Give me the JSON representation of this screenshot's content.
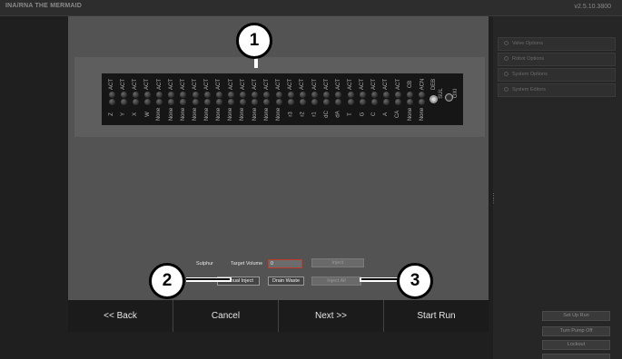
{
  "app": {
    "title": "INA/RNA THE MERMAID",
    "version": "v2.5.10.3800"
  },
  "right_panel": {
    "items": [
      "Valve Options",
      "Robot Options",
      "System Options",
      "System Editors"
    ],
    "buttons": [
      "Set Up Run",
      "Turn Pump Off",
      "Lockout",
      ""
    ]
  },
  "valves": {
    "top_labels": [
      "ACT",
      "ACT",
      "ACT",
      "ACT",
      "ACT",
      "ACT",
      "ACT",
      "ACT",
      "ACT",
      "ACT",
      "ACT",
      "ACT",
      "ACT",
      "ACT",
      "ACT",
      "ACT",
      "ACT",
      "ACT",
      "ACT",
      "ACT",
      "ACT",
      "ACT",
      "ACT",
      "ACT",
      "ACT",
      "CB",
      "ACN",
      "DEB"
    ],
    "bottom_labels": [
      "Z",
      "Y",
      "X",
      "W",
      "None",
      "None",
      "None",
      "None",
      "None",
      "None",
      "None",
      "None",
      "None",
      "None",
      "None",
      "r3",
      "r2",
      "r1",
      "dC",
      "dA",
      "T",
      "G",
      "C",
      "A",
      "CA",
      "None",
      "None"
    ],
    "extra_labels": [
      "SUL",
      "OXI"
    ]
  },
  "form": {
    "reagent_name": "Sulphur",
    "target_volume_label": "Target Volume",
    "target_volume_value": "0",
    "inject_label": "Inject",
    "manual_inject_label": "Manual Inject",
    "drain_waste_label": "Drain Waste",
    "inject_all_label": "Inject All"
  },
  "footer": {
    "back": "<< Back",
    "cancel": "Cancel",
    "next": "Next >>",
    "start_run": "Start Run"
  },
  "callouts": {
    "c1": "1",
    "c2": "2",
    "c3": "3"
  }
}
